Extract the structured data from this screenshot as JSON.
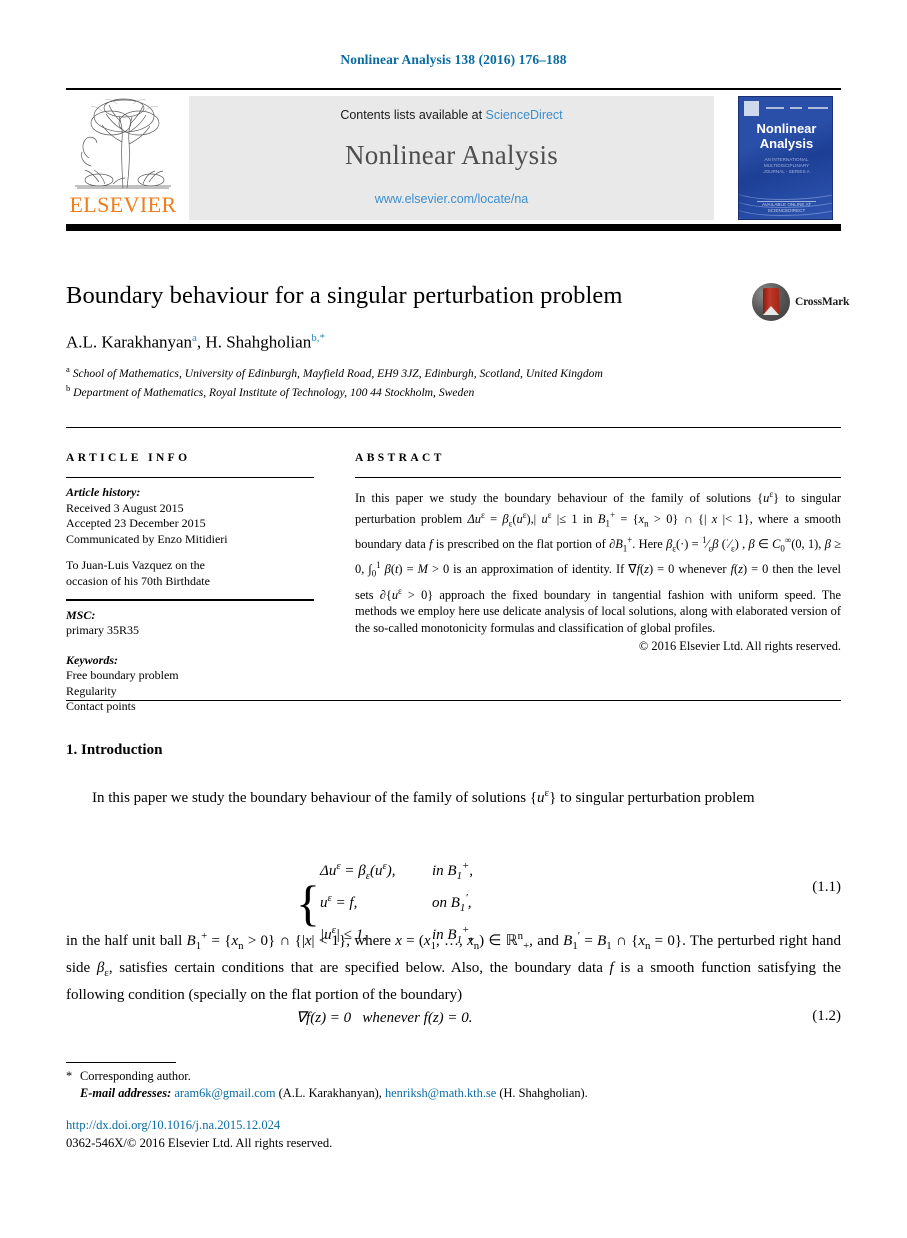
{
  "running_head": "Nonlinear Analysis 138 (2016) 176–188",
  "masthead": {
    "contents_prefix": "Contents lists available at ",
    "sciencedirect": "ScienceDirect",
    "journal_name": "Nonlinear Analysis",
    "journal_url": "www.elsevier.com/locate/na",
    "publisher_wordmark": "ELSEVIER",
    "cover": {
      "title_line1": "Nonlinear",
      "title_line2": "Analysis",
      "sub_line1": "AN INTERNATIONAL",
      "sub_line2": "MULTIDISCIPLINARY",
      "sub_line3": "JOURNAL - SERIES A",
      "foot_line1": "AVAILABLE ONLINE AT",
      "foot_line2": "SCIENCEDIRECT"
    }
  },
  "article": {
    "title": "Boundary behaviour for a singular perturbation problem",
    "crossmark_label": "CrossMark",
    "authors_plain": "A.L. Karakhanyan, H. Shahgholian",
    "author1": "A.L. Karakhanyan",
    "author1_mark": "a",
    "author2": "H. Shahgholian",
    "author2_mark": "b,*",
    "affiliation_a_mark": "a",
    "affiliation_a": "School of Mathematics, University of Edinburgh, Mayfield Road, EH9 3JZ, Edinburgh, Scotland, United Kingdom",
    "affiliation_b_mark": "b",
    "affiliation_b": "Department of Mathematics, Royal Institute of Technology, 100 44 Stockholm, Sweden"
  },
  "article_info": {
    "heading": "ARTICLE INFO",
    "history_label": "Article history:",
    "received": "Received 3 August 2015",
    "accepted": "Accepted 23 December 2015",
    "communicated": "Communicated by Enzo Mitidieri",
    "dedication_line1": "To Juan-Luis Vazquez on the",
    "dedication_line2": "occasion of his 70th Birthdate",
    "msc_label": "MSC:",
    "msc_value": "primary 35R35",
    "keywords_label": "Keywords:",
    "keywords": [
      "Free boundary problem",
      "Regularity",
      "Contact points"
    ]
  },
  "abstract": {
    "heading": "ABSTRACT",
    "text": "In this paper we study the boundary behaviour of the family of solutions {uᵋ} to singular perturbation problem Δuᵋ = βᵋ(uᵋ),| uᵋ |≤ 1 in B₁⁺ = {xₙ > 0} ∩ {| x |< 1}, where a smooth boundary data f is prescribed on the flat portion of ∂B₁⁺. Here βᵋ(·) = (1/ᵋ)β(·/ᵋ), β ∈ C₀^∞(0,1), β ≥ 0, ∫₀¹ β(t) = M > 0 is an approximation of identity. If ∇f(z) = 0 whenever f(z) = 0 then the level sets ∂{uᵋ > 0} approach the fixed boundary in tangential fashion with uniform speed. The methods we employ here use delicate analysis of local solutions, along with elaborated version of the so-called monotonicity formulas and classification of global profiles.",
    "copyright": "© 2016 Elsevier Ltd. All rights reserved."
  },
  "body": {
    "section1_heading": "1. Introduction",
    "para1": "In this paper we study the boundary behaviour of the family of solutions {uᵋ} to singular perturbation problem",
    "eq11": {
      "line1_lhs": "Δuᵋ = βᵋ(uᵋ),",
      "line1_rhs": "in B₁⁺,",
      "line2_lhs": "uᵋ = f,",
      "line2_rhs": "on B₁′,",
      "line3_lhs": "|uᵋ| ≤ 1,",
      "line3_rhs": "in B₁⁺,",
      "number": "(1.1)"
    },
    "para2": "in the half unit ball B₁⁺ = {xₙ > 0} ∩ {|x| < 1}, where x = (x₁, …, xₙ) ∈ ℝⁿ₊, and B₁′ = B₁ ∩ {xₙ = 0}. The perturbed right hand side βᵋ, satisfies certain conditions that are specified below. Also, the boundary data f is a smooth function satisfying the following condition (specially on the flat portion of the boundary)",
    "eq12": {
      "body": "∇f(z) = 0   whenever f(z) = 0.",
      "number": "(1.2)"
    }
  },
  "footnote": {
    "corresponding": "Corresponding author.",
    "email_label": "E-mail addresses:",
    "email1": "aram6k@gmail.com",
    "email1_owner": "(A.L. Karakhanyan),",
    "email2": "henriksh@math.kth.se",
    "email2_owner": "(H. Shahgholian)."
  },
  "footer": {
    "doi": "http://dx.doi.org/10.1016/j.na.2015.12.024",
    "issn_line": "0362-546X/© 2016 Elsevier Ltd. All rights reserved."
  },
  "colors": {
    "link_blue": "#0a6ba3",
    "sciencedirect_blue": "#3c8fce",
    "elsevier_orange": "#ef7d1a",
    "cover_blue": "#2a4fa8"
  }
}
